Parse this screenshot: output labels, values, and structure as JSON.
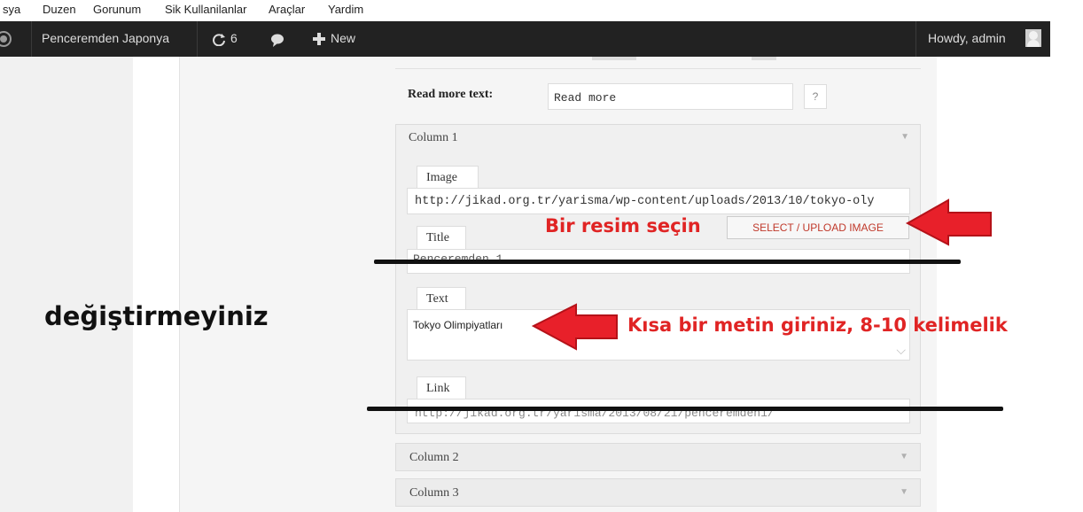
{
  "browser_menu": {
    "items": [
      "sya",
      "Duzen",
      "Gorunum",
      "Sik Kullanilanlar",
      "Araçlar",
      "Yardim"
    ]
  },
  "admin_bar": {
    "site_name": "Penceremden Japonya",
    "updates_count": "6",
    "new_label": "New",
    "howdy": "Howdy, admin",
    "icons": [
      "wordpress-logo-icon",
      "refresh-icon",
      "comment-bubble-icon",
      "plus-icon",
      "user-avatar-icon"
    ]
  },
  "form": {
    "read_more_label": "Read more text:",
    "read_more_value": "Read more",
    "help_label": "?",
    "column1": {
      "header": "Column 1",
      "image_tab": "Image",
      "image_url": "http://jikad.org.tr/yarisma/wp-content/uploads/2013/10/tokyo-oly",
      "select_button": "SELECT / UPLOAD IMAGE",
      "title_tab": "Title",
      "title_value": "Penceremden 1",
      "text_tab": "Text",
      "text_value": "Tokyo Olimpiyatları",
      "link_tab": "Link",
      "link_value": "http://jikad.org.tr/yarisma/2013/08/21/penceremden1/"
    },
    "column2_header": "Column 2",
    "column3_header": "Column 3"
  },
  "annotations": {
    "choose_image": "Bir resim seçin",
    "do_not_change": "değiştirmeyiniz",
    "enter_text": "Kısa bir metin giriniz, 8-10 kelimelik",
    "arrow_color": "#e8202a"
  }
}
